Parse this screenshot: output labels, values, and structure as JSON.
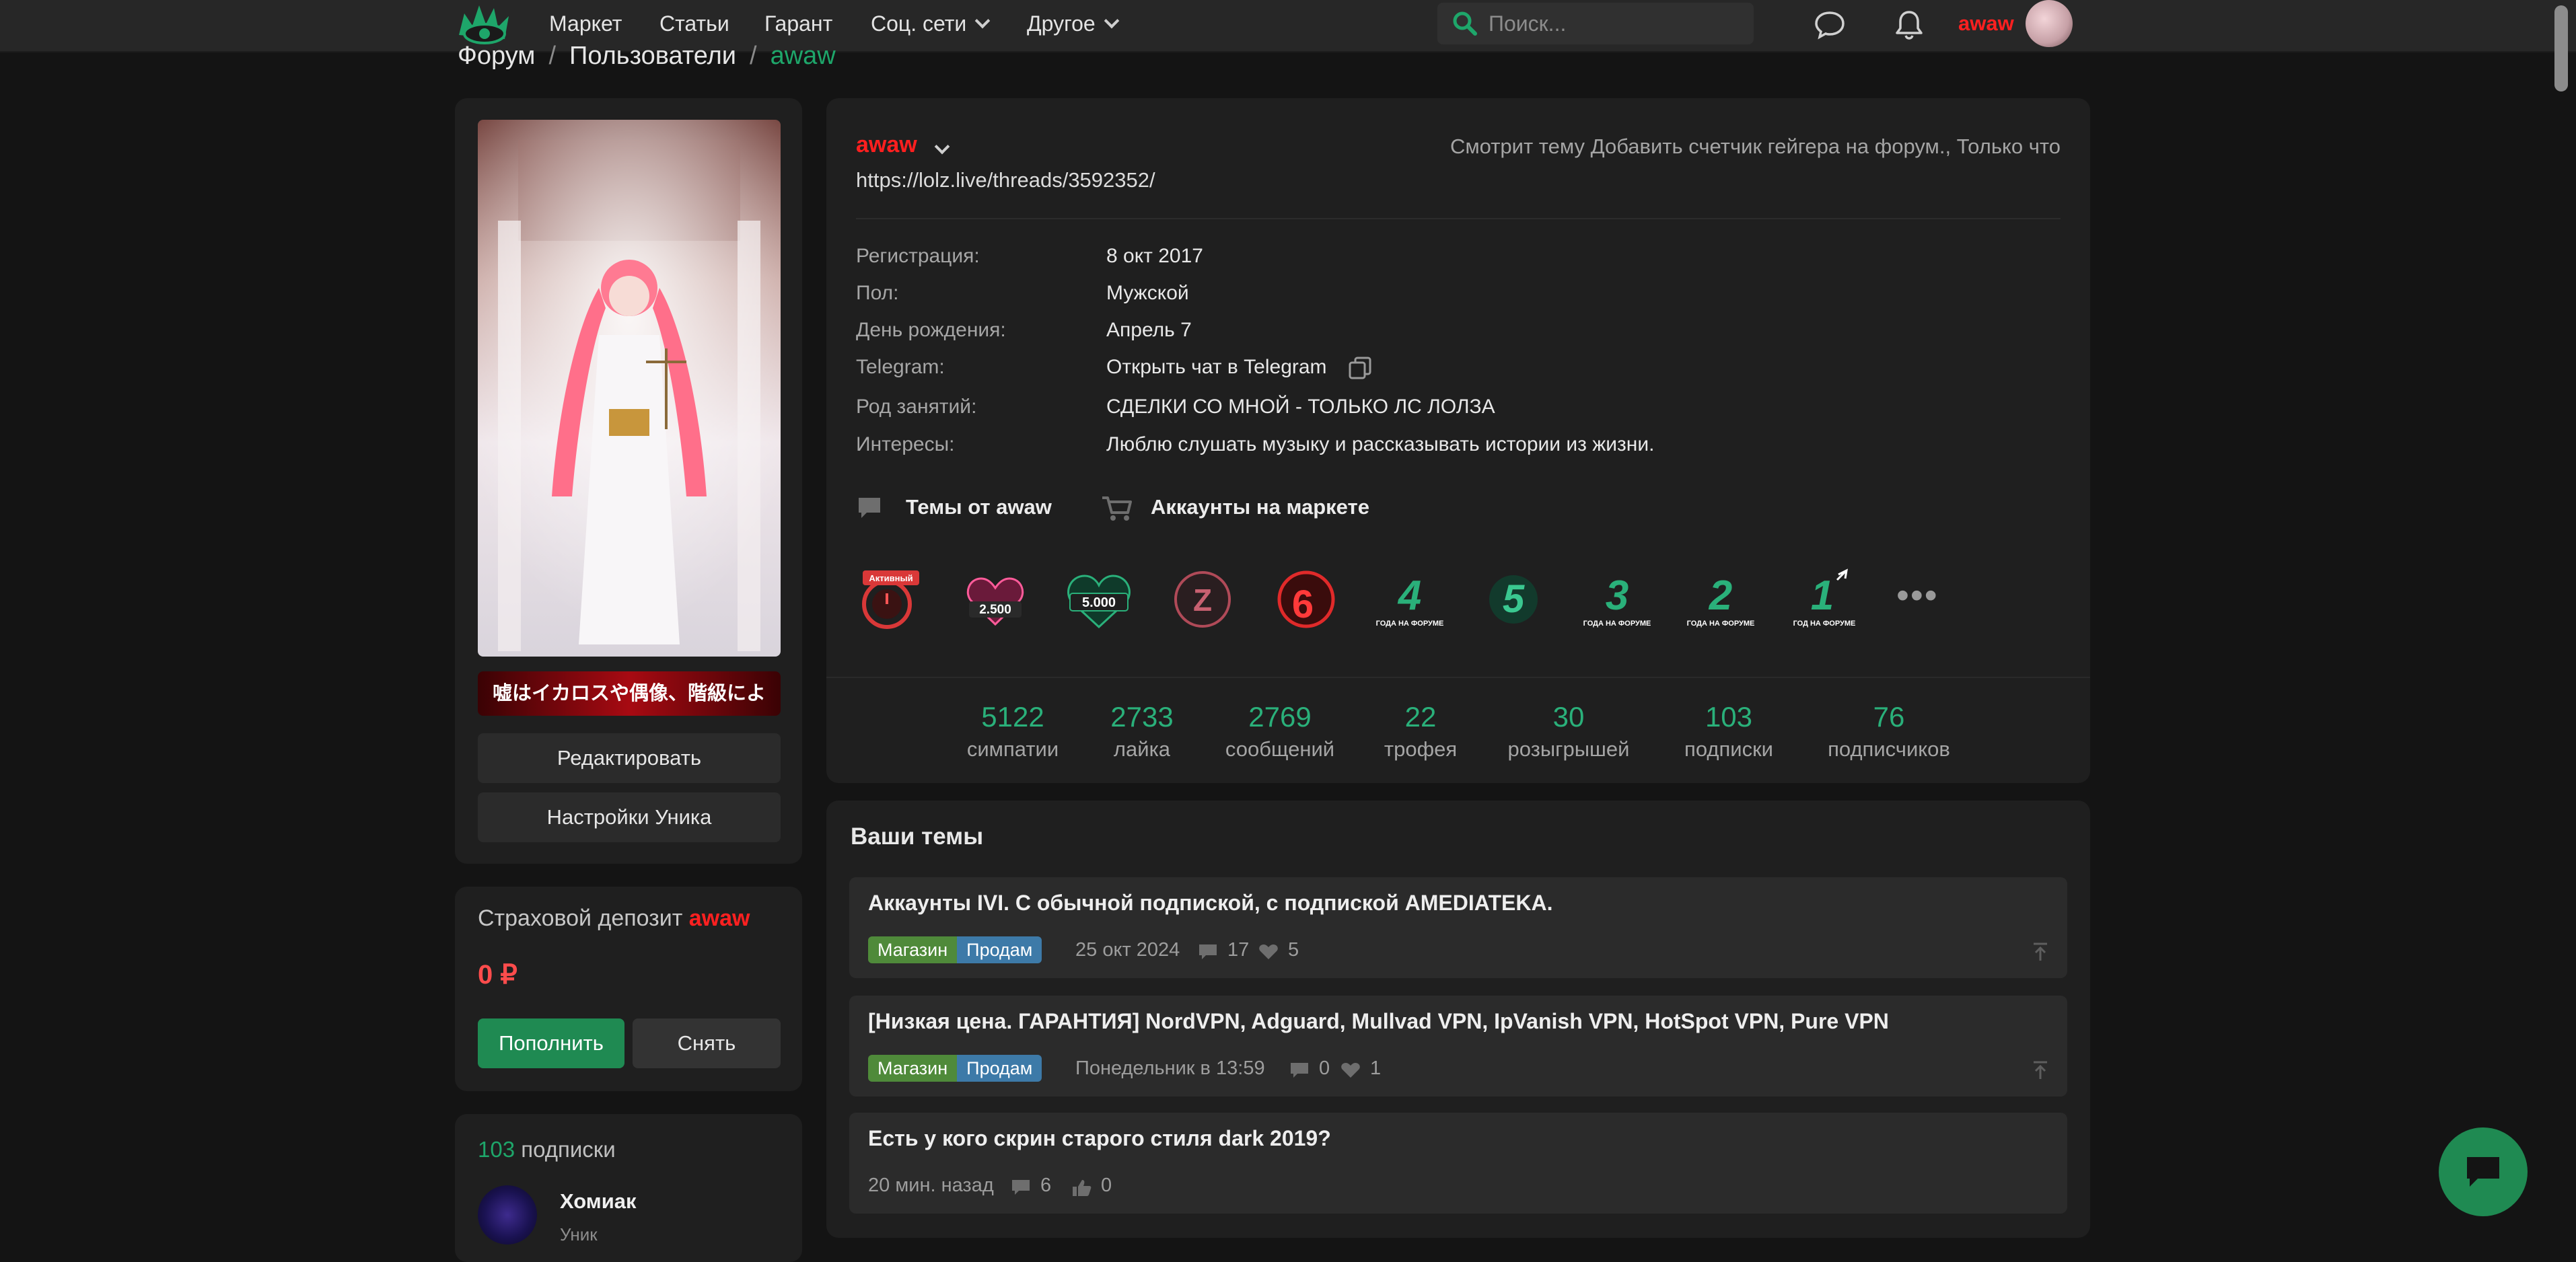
{
  "nav": {
    "logo_icon": "eye-logo-icon",
    "items": [
      {
        "label": "Маркет"
      },
      {
        "label": "Статьи"
      },
      {
        "label": "Гарант"
      },
      {
        "label": "Соц. сети"
      },
      {
        "label": "Другое"
      }
    ],
    "search_placeholder": "Поиск...",
    "username": "awaw"
  },
  "breadcrumb": [
    "Форум",
    "Пользователи",
    "awaw"
  ],
  "sidebar": {
    "banner_text": "嘘はイカロスや偶像、階級によ",
    "edit_label": "Редактировать",
    "unique_settings_label": "Настройки Уника",
    "deposit_title": "Страховой депозит",
    "deposit_user": "awaw",
    "deposit_amount": "0 ₽",
    "topup_label": "Пополнить",
    "withdraw_label": "Снять",
    "subs_count": "103",
    "subs_label": "подписки",
    "sub_name": "Хомиак",
    "sub_role": "Уник"
  },
  "profile": {
    "username": "awaw",
    "status": "Смотрит тему Добавить счетчик гейгера на форум., Только что",
    "link": "https://lolz.live/threads/3592352/",
    "info": [
      {
        "label": "Регистрация:",
        "value": "8 окт 2017"
      },
      {
        "label": "Пол:",
        "value": "Мужской"
      },
      {
        "label": "День рождения:",
        "value": "Апрель 7"
      },
      {
        "label": "Telegram:",
        "value": "Открыть чат в Telegram"
      },
      {
        "label": "Род занятий:",
        "value": "СДЕЛКИ СО МНОЙ - ТОЛЬКО ЛС ЛОЛЗА"
      },
      {
        "label": "Интересы:",
        "value": "Люблю слушать музыку и рассказывать истории из жизни."
      }
    ],
    "topics_link": "Темы от awaw",
    "market_link": "Аккаунты на маркете",
    "trophies": [
      {
        "text": "Активный",
        "color": "#e03a3a"
      },
      {
        "text": "2.500",
        "color": "#e0407a"
      },
      {
        "text": "5.000",
        "color": "#2ab07a"
      },
      {
        "text": "Z",
        "color": "#c04a5a"
      },
      {
        "text": "6",
        "color": "#e02a2a"
      },
      {
        "text": "4",
        "color": "#2ab07a"
      },
      {
        "text": "5",
        "color": "#2ab07a"
      },
      {
        "text": "3",
        "color": "#2ab07a"
      },
      {
        "text": "2",
        "color": "#2ab07a"
      },
      {
        "text": "1",
        "color": "#2ab07a"
      }
    ],
    "trophy_caption": "ГОДА НА ФОРУМЕ",
    "trophy_caption_single": "ГОД НА ФОРУМЕ",
    "more_label": "•••",
    "stats": [
      {
        "value": "5122",
        "label": "симпатии"
      },
      {
        "value": "2733",
        "label": "лайка"
      },
      {
        "value": "2769",
        "label": "сообщений"
      },
      {
        "value": "22",
        "label": "трофея"
      },
      {
        "value": "30",
        "label": "розыгрышей"
      },
      {
        "value": "103",
        "label": "подписки"
      },
      {
        "value": "76",
        "label": "подписчиков"
      }
    ]
  },
  "threads": {
    "title": "Ваши темы",
    "items": [
      {
        "title": "Аккаунты IVI. С обычной подпиской, с подпиской AMEDIATEKA.",
        "tags": [
          "Магазин",
          "Продам"
        ],
        "date": "25 окт 2024",
        "replies": "17",
        "likes": "5"
      },
      {
        "title": "[Низкая цена. ГАРАНТИЯ] NordVPN, Adguard, Mullvad VPN, IpVanish VPN, HotSpot VPN, Pure VPN",
        "tags": [
          "Магазин",
          "Продам"
        ],
        "date": "Понедельник в 13:59",
        "replies": "0",
        "likes": "1"
      },
      {
        "title": "Есть у кого скрин старого стиля dark 2019?",
        "tags": [],
        "date": "20 мин. назад",
        "replies": "6",
        "likes": "0"
      }
    ]
  },
  "colors": {
    "accent": "#1ea66a",
    "username": "#ff1f1f",
    "background": "#141414",
    "card": "#1f1f1f"
  }
}
